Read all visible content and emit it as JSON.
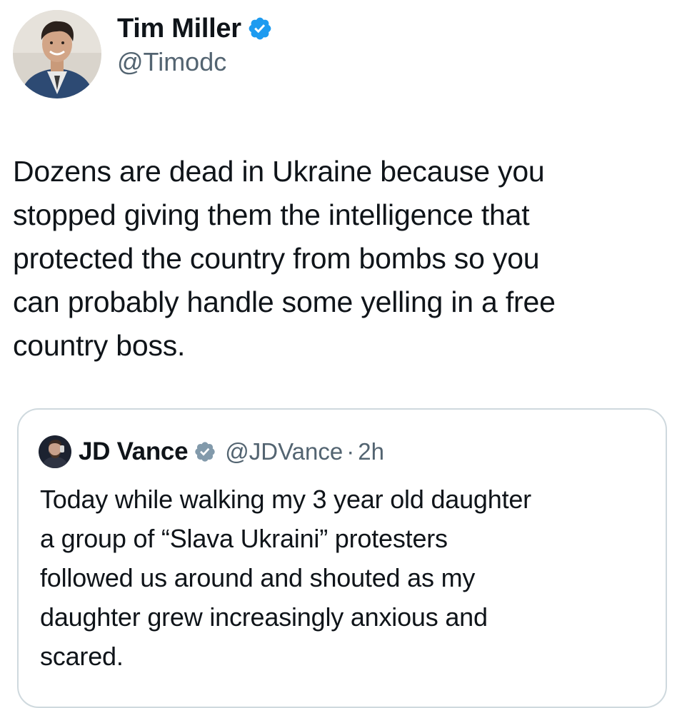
{
  "tweet": {
    "author": {
      "display_name": "Tim Miller",
      "handle": "@Timodc",
      "avatar_icon": "profile-photo",
      "verified_icon": "verified-badge-icon"
    },
    "body_lines": [
      "Dozens are dead in Ukraine because you",
      "stopped giving them the intelligence that",
      "protected the country from bombs so you",
      "can probably handle some yelling in a free",
      "country boss."
    ]
  },
  "quoted_tweet": {
    "author": {
      "display_name": "JD Vance",
      "handle": "@JDVance",
      "separator": "·",
      "time": "2h",
      "avatar_icon": "profile-photo",
      "verified_icon": "verified-badge-icon"
    },
    "body_lines": [
      "Today while walking my 3 year old daughter",
      "a group of “Slava Ukraini” protesters",
      "followed us around and shouted as my",
      "daughter grew increasingly anxious and",
      "scared."
    ]
  },
  "colors": {
    "verified_blue": "#1d9bf0",
    "verified_gray": "#829aab",
    "secondary_text": "#536471",
    "primary_text": "#0f1419",
    "card_border": "#cfd9de"
  }
}
